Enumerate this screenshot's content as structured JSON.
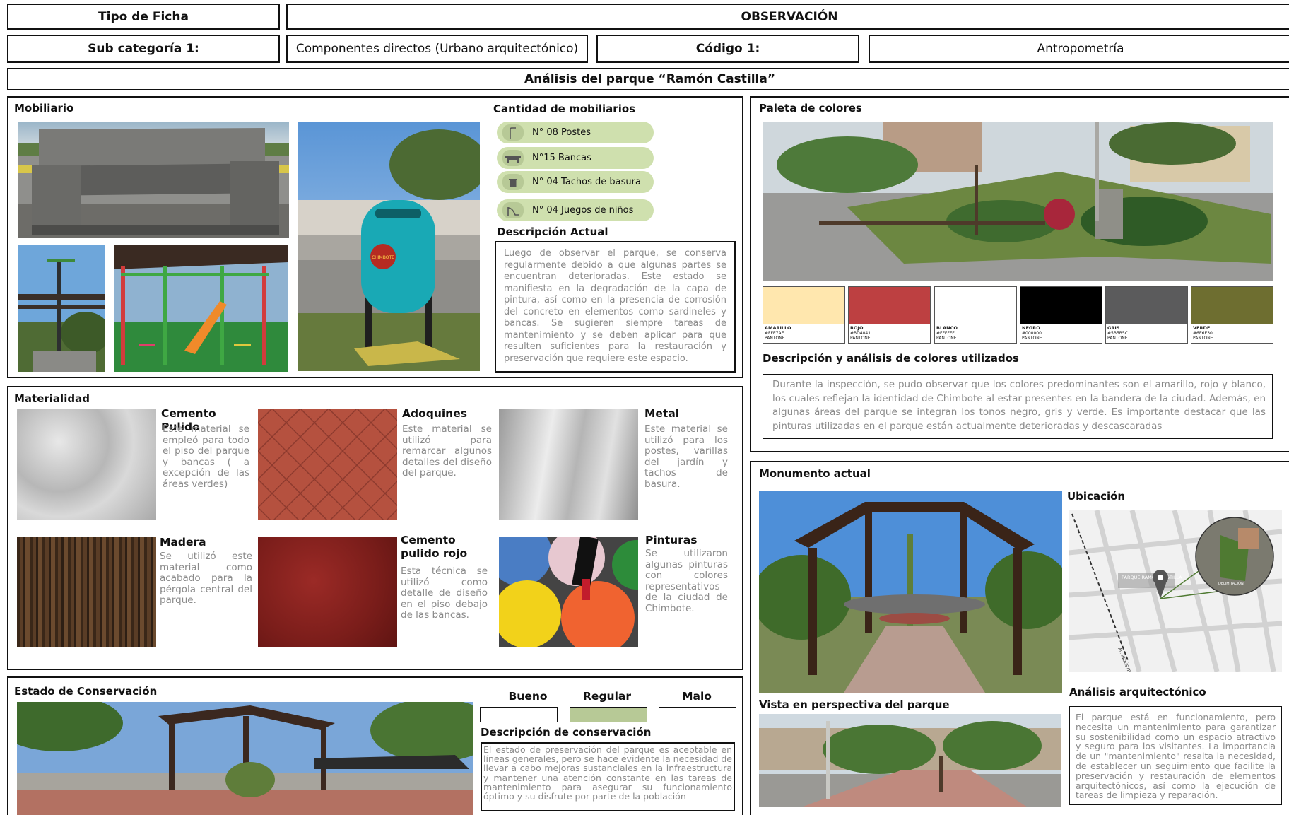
{
  "header": {
    "tipo_label": "Tipo de Ficha",
    "tipo_value": "OBSERVACIÓN",
    "subcat_label": "Sub categoría 1:",
    "subcat_value": "Componentes directos (Urbano arquitectónico)",
    "codigo_label": "Código 1:",
    "codigo_value": "Antropometría",
    "analysis_title": "Análisis del parque “Ramón Castilla”"
  },
  "mobiliario": {
    "title": "Mobiliario",
    "cantidad_title": "Cantidad de mobiliarios",
    "items": [
      {
        "icon": "lamp-post-icon",
        "label": "N° 08  Postes"
      },
      {
        "icon": "bench-icon",
        "label": "N°15  Bancas"
      },
      {
        "icon": "trash-bin-icon",
        "label": "N° 04  Tachos de basura"
      },
      {
        "icon": "slide-icon",
        "label": "N° 04  Juegos de niños"
      }
    ],
    "descripcion_title": "Descripción Actual",
    "descripcion_text": "Luego de observar el parque, se conserva regularmente debido a que algunas partes se encuentran deterioradas. Este estado se manifiesta en la degradación de la capa de pintura, así como en la presencia de corrosión del concreto en elementos como sardineles y bancas. Se sugieren siempre tareas de mantenimiento y se deben aplicar para que resulten suficientes para la restauración y preservación que requiere este espacio.",
    "trash_emblem": "CHIMBOTE"
  },
  "paleta": {
    "title": "Paleta de colores",
    "swatches": [
      {
        "name": "AMARILLO",
        "hex": "#FFE7AE",
        "pantone": "PANTONE"
      },
      {
        "name": "ROJO",
        "hex": "#BD4041",
        "pantone": "PANTONE"
      },
      {
        "name": "BLANCO",
        "hex": "#FFFFFF",
        "pantone": "PANTONE"
      },
      {
        "name": "NEGRO",
        "hex": "#000000",
        "pantone": "PANTONE"
      },
      {
        "name": "GRIS",
        "hex": "#5B5B5C",
        "pantone": "PANTONE"
      },
      {
        "name": "VERDE",
        "hex": "#6E6E30",
        "pantone": "PANTONE"
      }
    ],
    "desc_title": "Descripción y análisis de colores utilizados",
    "desc_text": "Durante la inspección, se pudo observar que los colores predominantes son el amarillo, rojo y blanco, los cuales reflejan la identidad de Chimbote al estar presentes en la bandera de la ciudad. Además, en algunas áreas del parque se integran los tonos negro, gris y verde. Es importante destacar que las pinturas utilizadas en el parque están actualmente deterioradas y descascaradas"
  },
  "materialidad": {
    "title": "Materialidad",
    "items": [
      {
        "title": "Cemento Pulido",
        "text": "Este material se empleó para todo el piso del parque y bancas ( a excepción de las áreas verdes)"
      },
      {
        "title": "Adoquines",
        "text": "Este material se utilizó para remarcar algunos detalles del diseño del parque."
      },
      {
        "title": "Metal",
        "text": "Este material se utilizó para los postes, varillas del jardín y tachos de basura."
      },
      {
        "title": "Madera",
        "text": "Se utilizó este material como acabado para la pérgola central del parque."
      },
      {
        "title": "Cemento pulido rojo",
        "text": "Esta técnica se utilizó como detalle de diseño en el piso debajo de las bancas."
      },
      {
        "title": "Pinturas",
        "text": "Se utilizaron algunas pinturas con colores representativos de la ciudad de Chimbote."
      }
    ]
  },
  "monumento": {
    "title": "Monumento actual",
    "ubicacion_title": "Ubicación",
    "map_label_park": "PARQUE RAMÓN CASTILLA",
    "map_label_street": "AV. INDUSTRIAL",
    "map_label_zone": "DELIMITACIÓN",
    "perspectiva_title": "Vista en perspectiva del parque",
    "analisis_title": "Análisis arquitectónico",
    "analisis_text": "El parque está en funcionamiento, pero necesita un mantenimiento para garantizar su sostenibilidad como un espacio atractivo y seguro para los visitantes. La importancia de un \"mantenimiento\" resalta la necesidad, de establecer un seguimiento que facilite la preservación y restauración de elementos arquitectónicos, así como la ejecución de tareas de limpieza y reparación."
  },
  "conservacion": {
    "title": "Estado de Conservación",
    "options": [
      {
        "label": "Bueno",
        "selected": false
      },
      {
        "label": "Regular",
        "selected": true
      },
      {
        "label": "Malo",
        "selected": false
      }
    ],
    "selected_color": "#b7c996",
    "desc_title": "Descripción de conservación",
    "desc_text": "El estado de preservación del parque es aceptable en líneas generales, pero se hace evidente la necesidad de llevar a cabo mejoras sustanciales en la infraestructura y mantener una atención constante en las tareas de mantenimiento para asegurar su funcionamiento óptimo y su disfrute por parte de la población"
  }
}
